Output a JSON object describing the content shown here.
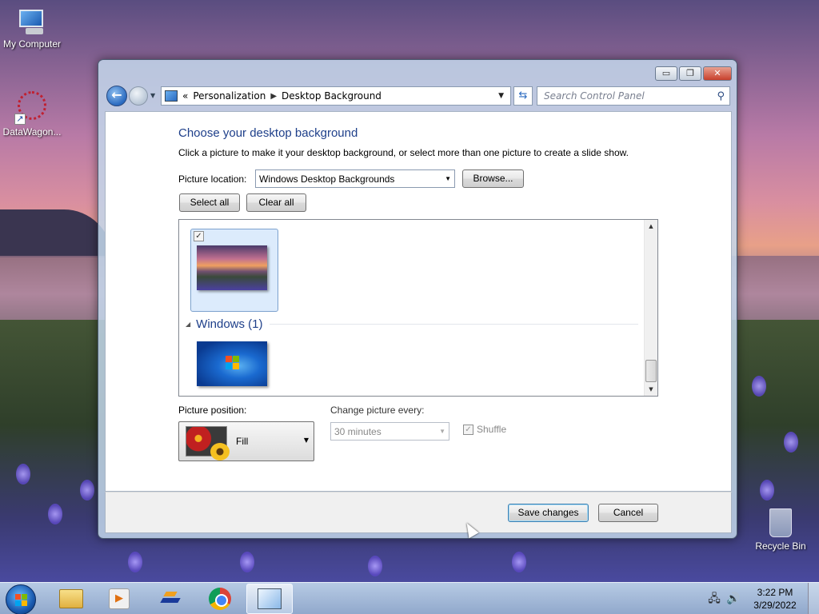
{
  "desktop": {
    "icons": [
      {
        "label": "My Computer"
      },
      {
        "label": "DataWagon..."
      },
      {
        "label": "Recycle Bin"
      }
    ]
  },
  "window": {
    "caption_buttons": {
      "minimize": "▭",
      "maximize": "❐",
      "close": "✕"
    },
    "address": {
      "crumbs": [
        "Personalization",
        "Desktop Background"
      ],
      "overflow": "«"
    },
    "search": {
      "placeholder": "Search Control Panel"
    },
    "title": "Choose your desktop background",
    "subtitle": "Click a picture to make it your desktop background, or select more than one picture to create a slide show.",
    "picture_location": {
      "label": "Picture location:",
      "value": "Windows Desktop Backgrounds",
      "browse": "Browse..."
    },
    "buttons": {
      "select_all": "Select all",
      "clear_all": "Clear all"
    },
    "list": {
      "group_header": "Windows (1)",
      "first_tile_checked": true
    },
    "picture_position": {
      "label": "Picture position:",
      "value": "Fill"
    },
    "change_every": {
      "label": "Change picture every:",
      "value": "30 minutes"
    },
    "shuffle": {
      "label": "Shuffle",
      "checked": true,
      "disabled": true
    },
    "footer": {
      "save": "Save changes",
      "cancel": "Cancel"
    }
  },
  "taskbar": {
    "items": [
      "explorer-icon",
      "media-player-icon",
      "datawagon-icon",
      "chrome-icon",
      "control-panel-icon"
    ],
    "active_item": "control-panel-icon",
    "clock": {
      "time": "3:22 PM",
      "date": "3/29/2022"
    }
  },
  "colors": {
    "heading": "#1e3f8a",
    "selection": "#dcebfc",
    "default_button_border": "#3c7fb1"
  }
}
